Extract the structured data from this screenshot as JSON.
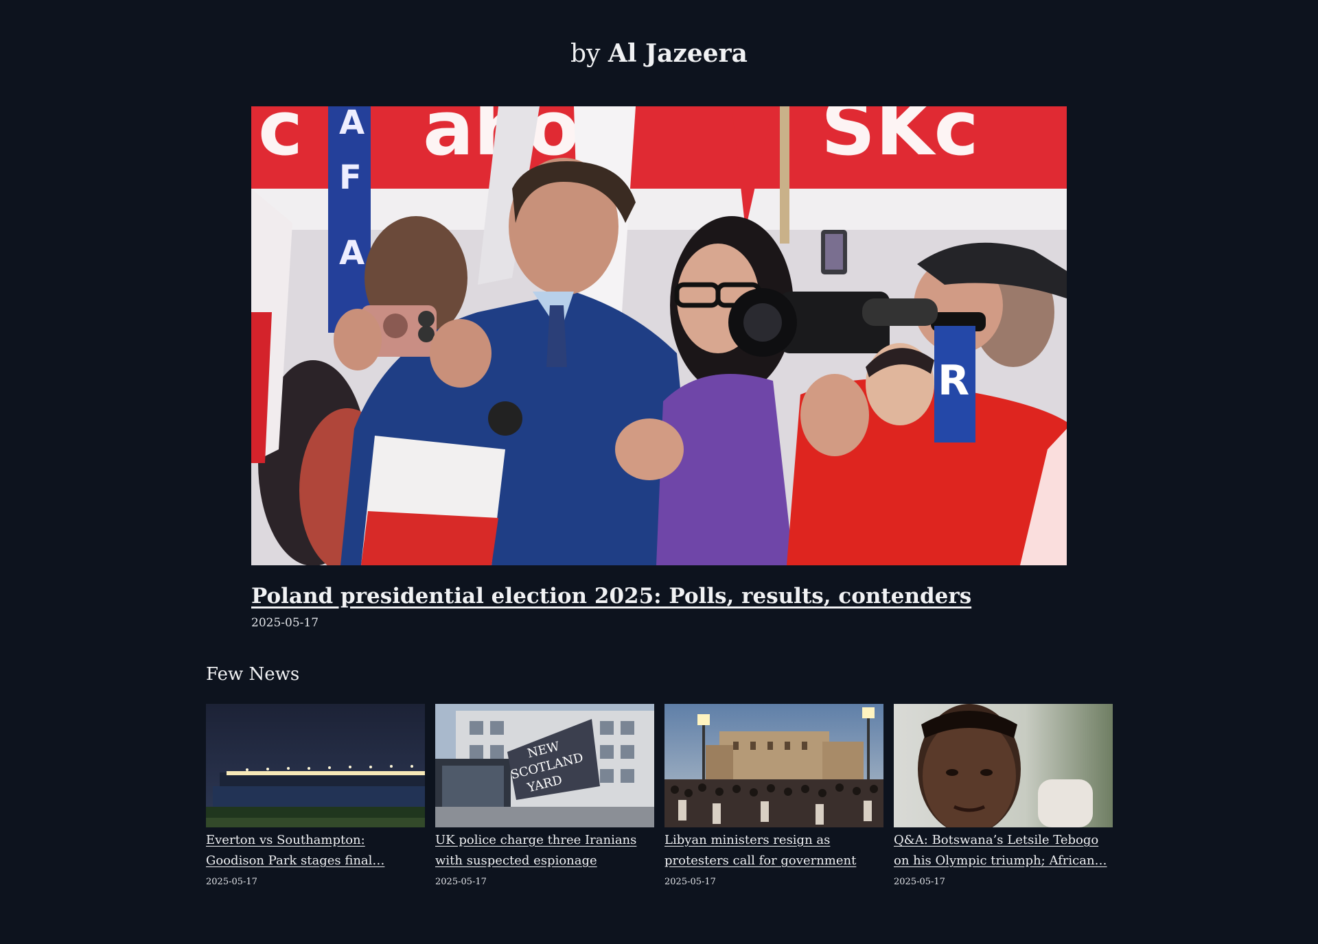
{
  "header": {
    "byline_prefix": "by",
    "byline_name": "Al Jazeera"
  },
  "hero": {
    "title": "Poland presidential election 2025: Polls, results, contenders",
    "date": "2025-05-17",
    "image_alt": "Candidate taking a selfie with supporters at a rally, Polish flags in background"
  },
  "section": {
    "title": "Few News"
  },
  "cards": [
    {
      "title": "Everton vs Southampton: Goodison Park stages final…",
      "date": "2025-05-17",
      "image_alt": "Goodison Park stadium lit at night"
    },
    {
      "title": "UK police charge three Iranians with suspected espionage",
      "date": "2025-05-17",
      "image_alt": "New Scotland Yard sign"
    },
    {
      "title": "Libyan ministers resign as protesters call for government to…",
      "date": "2025-05-17",
      "image_alt": "Crowd of protesters in a square at dusk"
    },
    {
      "title": "Q&A: Botswana’s Letsile Tebogo on his Olympic triumph; African…",
      "date": "2025-05-17",
      "image_alt": "Portrait of Letsile Tebogo"
    }
  ],
  "image_text": {
    "sign_line1": "NEW",
    "sign_line2": "SCOTLAND",
    "sign_line3": "YARD"
  }
}
